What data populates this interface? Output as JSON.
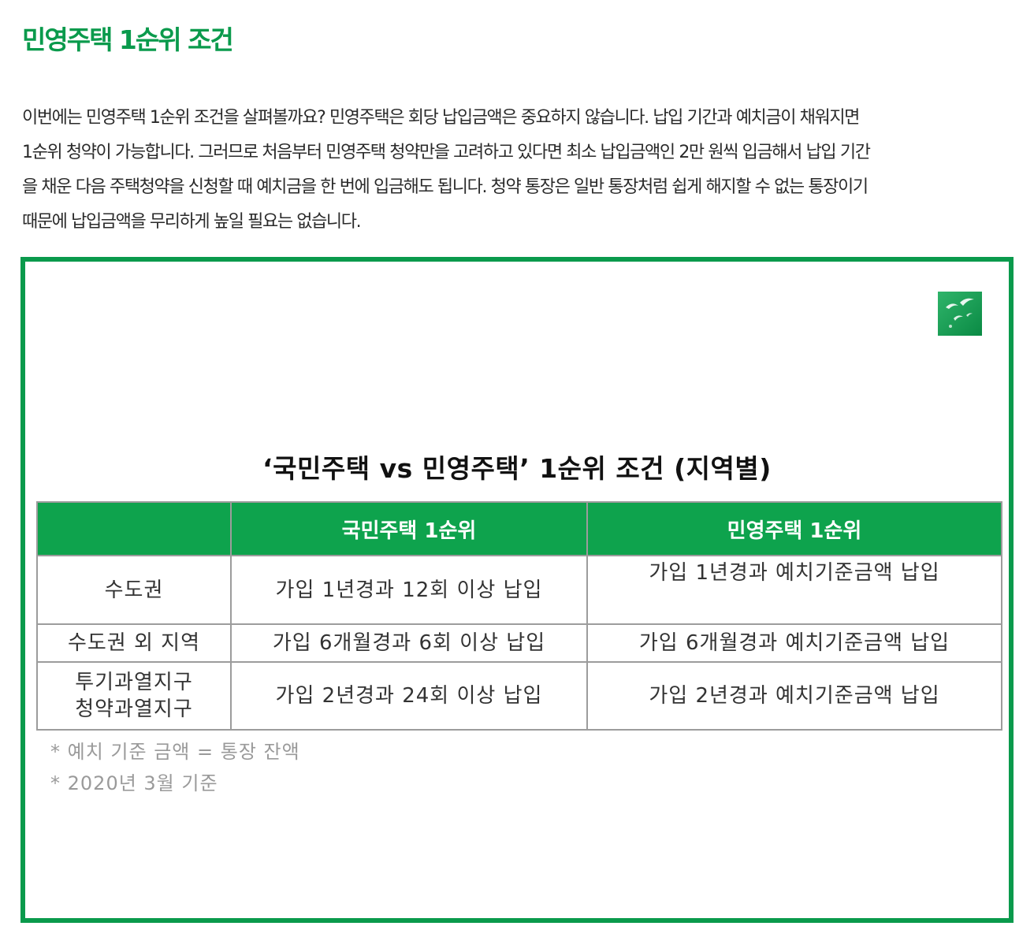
{
  "heading": "민영주택 1순위 조건",
  "paragraph_lines": [
    "이번에는 민영주택 1순위 조건을 살펴볼까요? 민영주택은 회당 납입금액은 중요하지 않습니다. 납입 기간과 예치금이 채워지면",
    "1순위 청약이 가능합니다. 그러므로 처음부터 민영주택 청약만을 고려하고 있다면 최소 납입금액인 2만 원씩 입금해서 납입 기간",
    "을 채운 다음 주택청약을 신청할 때 예치금을 한 번에 입금해도 됩니다. 청약 통장은 일반 통장처럼 쉽게 해지할 수 없는 통장이기",
    "때문에 납입금액을 무리하게 높일 필요는 없습니다."
  ],
  "infographic": {
    "title": "‘국민주택 vs 민영주택’ 1순위 조건 (지역별)",
    "headers": [
      "",
      "국민주택 1순위",
      "민영주택 1순위"
    ],
    "rows": [
      {
        "region": "수도권",
        "national": "가입 1년경과 12회 이상 납입",
        "private": "가입 1년경과 예치기준금액 납입"
      },
      {
        "region": "수도권 외 지역",
        "national": "가입 6개월경과 6회 이상 납입",
        "private": "가입 6개월경과 예치기준금액 납입"
      },
      {
        "region_line1": "투기과열지구",
        "region_line2": "청약과열지구",
        "national": "가입 2년경과 24회 이상 납입",
        "private": "가입 2년경과 예치기준금액 납입"
      }
    ],
    "notes": [
      "* 예치 기준 금액 = 통장 잔액",
      "* 2020년 3월 기준"
    ]
  },
  "colors": {
    "accent": "#0a9a4c",
    "header_bg": "#0ea34d",
    "note": "#9a9a9a"
  },
  "icons": {
    "logo": "bird-logo-icon"
  }
}
